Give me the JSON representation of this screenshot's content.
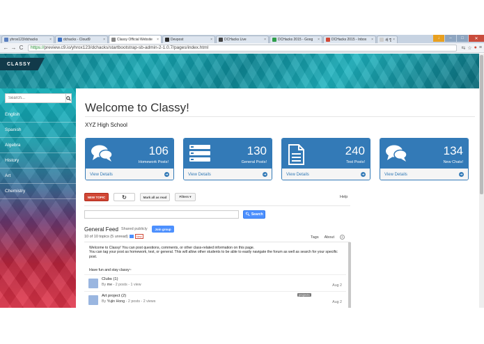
{
  "browser": {
    "tabs": [
      {
        "label": "yhrox123/dchacks",
        "color": "#5a7fbf",
        "active": false
      },
      {
        "label": "dchacks - Cloud9",
        "color": "#3b6fc2",
        "active": false
      },
      {
        "label": "Classy Official Website",
        "color": "#888888",
        "active": true
      },
      {
        "label": "Devpost",
        "color": "#2a2a2a",
        "active": false
      },
      {
        "label": "DCHacks Live",
        "color": "#444444",
        "active": false
      },
      {
        "label": "DCHacks 2015 - Goog",
        "color": "#2e9e4a",
        "active": false
      },
      {
        "label": "DCHacks 2015 - Inbox",
        "color": "#d14836",
        "active": false
      },
      {
        "label": "새 탭",
        "color": "#cccccc",
        "active": false
      }
    ],
    "url_scheme": "https://",
    "url_rest": "preview.c9.io/yhrox123/dchacks/startbootstrap-sb-admin-2-1.0.7/pages/index.html"
  },
  "brand": "CLASSY",
  "sidebar": {
    "search_placeholder": "Search...",
    "items": [
      "English",
      "Spanish",
      "Algebra",
      "History",
      "Art",
      "Chemistry"
    ]
  },
  "main": {
    "title": "Welcome to Classy!",
    "school": "XYZ High School",
    "cards": [
      {
        "number": "106",
        "label": "Homework Posts!",
        "link": "View Details",
        "icon": "comments-icon"
      },
      {
        "number": "130",
        "label": "General Posts!",
        "link": "View Details",
        "icon": "list-icon"
      },
      {
        "number": "240",
        "label": "Test Posts!",
        "link": "View Details",
        "icon": "document-icon"
      },
      {
        "number": "134",
        "label": "New Chats!",
        "link": "View Details",
        "icon": "comments-icon"
      }
    ]
  },
  "forum": {
    "new_topic": "NEW TOPIC",
    "mark_read": "Mark all as read",
    "filters": "Filters ▾",
    "help": "Help",
    "search_button": "Search",
    "feed_title": "General Feed",
    "shared": "Shared publicly",
    "join_group": "Join group",
    "tags": "Tags",
    "about": "About",
    "count": "10 of 10 topics (5 unread)",
    "new_badge": "New",
    "desc1": "Welcome to Classy! You can post questions, comments, or other class-related information on this page.",
    "desc2": "You can tag your post as homework, test, or general. This will allow other students to be able to easily navigate the forum as well as search for your specific post.",
    "have_fun": "Have fun and stay classy~",
    "topics": [
      {
        "title": "Clubs",
        "replies": "(1)",
        "by_label": "By",
        "author": "me",
        "stats": " - 2 posts - 1 view",
        "date": "Aug 2",
        "tag": ""
      },
      {
        "title": "Art project",
        "replies": "(2)",
        "by_label": "By",
        "author": "Yujin Hong",
        "stats": " - 2 posts - 2 views",
        "date": "Aug 2",
        "tag": "projects"
      }
    ]
  }
}
